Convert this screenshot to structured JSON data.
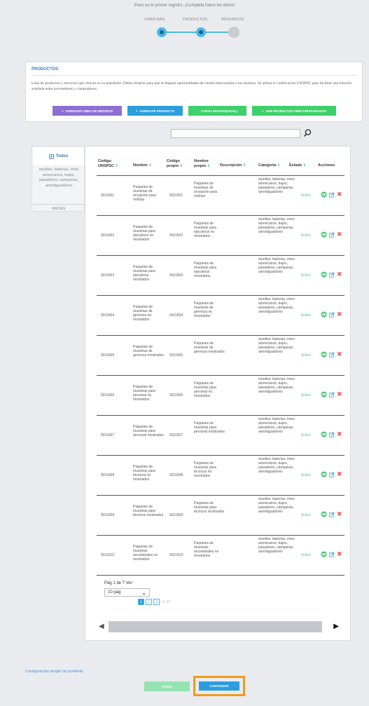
{
  "header": {
    "message": "Paso es tu primer registro. ¡Completa todos los datos!"
  },
  "steps": [
    {
      "label": "LÍNEA NAG."
    },
    {
      "label": "PRODUCTOS"
    },
    {
      "label": "REFERIDOS"
    }
  ],
  "products": {
    "title": "PRODUCTOS",
    "description": "Lista de productos y servicios que ofreces en su portafolio. Debes listarlos para que te lleguen oportunidades de ventas relacionadas a los mismos. Se utiliza la codificación UNSPSC para facilitar una relación acertada entre proveedores y compradores.",
    "buttons": {
      "add_line": "AGREGAR LÍNEA DE NEGOCIO",
      "add_product": "AGREGAR PRODUCTO",
      "bulk_load": "CARGA MASIVA(EXCEL)",
      "view_preconfigured": "VER PRODUCTOS PRECONFIGURADOS"
    }
  },
  "search": {
    "placeholder": ""
  },
  "sidebar": {
    "tab_all": "Todos",
    "category": "muelles, baterías, rines americanos, bujes, pasadores, campanas, amortiguadores",
    "networks": "REDES"
  },
  "table": {
    "headers": {
      "unspsc": "Código UNSPSC",
      "name": "Nombre",
      "own_code": "Código propio",
      "own_name": "Nombre propio",
      "description": "Descripción",
      "category": "Categoría",
      "state": "Estado",
      "actions": "Acciones"
    },
    "rows": [
      {
        "code": "5011501",
        "name": "Paquetes de muestras de recepción para orishas",
        "own_code": "5011501",
        "own_name": "Paquetes de muestras de recepción para orishas",
        "category": "muelles, baterías, rines americanos, bujes, pasadores, campanas, amortiguadores",
        "state": "Activo"
      },
      {
        "code": "5011502",
        "name": "Paquetes de muestras para ejecutivos no mostrados",
        "own_code": "5011502",
        "own_name": "Paquetes de muestras para ejecutivos no mostrados",
        "category": "muelles, baterías, rines americanos, bujes, pasadores, campanas, amortiguadores",
        "state": "Activo"
      },
      {
        "code": "5011503",
        "name": "Paquetes de muestras para ejecutivos mostrados",
        "own_code": "5011503",
        "own_name": "Paquetes de muestras para ejecutivos mostrados",
        "category": "muelles, baterías, rines americanos, bujes, pasadores, campanas, amortiguadores",
        "state": "Activo"
      },
      {
        "code": "5011504",
        "name": "Paquetes de muestras de gerencia no mostrados",
        "own_code": "5011504",
        "own_name": "Paquetes de muestras de gerencia no mostrados",
        "category": "muelles, baterías, rines americanos, bujes, pasadores, campanas, amortiguadores",
        "state": "Activo"
      },
      {
        "code": "5011505",
        "name": "Paquetes de muestras de gerencia mostrados",
        "own_code": "5011505",
        "own_name": "Paquetes de muestras de gerencia mostrados",
        "category": "muelles, baterías, rines americanos, bujes, pasadores, campanas, amortiguadores",
        "state": "Activo"
      },
      {
        "code": "5011506",
        "name": "Paquetes de muestras para personal no mostrados",
        "own_code": "5011506",
        "own_name": "Paquetes de muestras para personal no mostrados",
        "category": "muelles, baterías, rines americanos, bujes, pasadores, campanas, amortiguadores",
        "state": "Activo"
      },
      {
        "code": "5011507",
        "name": "Paquetes de muestras para personal mostrados",
        "own_code": "5011507",
        "own_name": "Paquetes de muestras para personal mostrados",
        "category": "muelles, baterías, rines americanos, bujes, pasadores, campanas, amortiguadores",
        "state": "Activo"
      },
      {
        "code": "5011508",
        "name": "Paquetes de muestras para técnicos no mostrados",
        "own_code": "5011508",
        "own_name": "Paquetes de muestras para técnicos no mostrados",
        "category": "muelles, baterías, rines americanos, bujes, pasadores, campanas, amortiguadores",
        "state": "Activo"
      },
      {
        "code": "5011509",
        "name": "Paquetes de muestras para técnicos mostrados",
        "own_code": "5011509",
        "own_name": "Paquetes de muestras para técnicos mostrados",
        "category": "muelles, baterías, rines americanos, bujes, pasadores, campanas, amortiguadores",
        "state": "Activo"
      },
      {
        "code": "5011510",
        "name": "Paquetes de muestras secretariales no mostrados",
        "own_code": "5011510",
        "own_name": "Paquetes de muestras secretariales no mostrados",
        "category": "muelles, baterías, rines americanos, bujes, pasadores, campanas, amortiguadores",
        "state": "Activo"
      }
    ]
  },
  "pagination": {
    "text": "Pág 1 de 7 Ver:",
    "per_page": "10 pág",
    "pages": [
      "1",
      "2",
      "3"
    ],
    "nav": "> >>"
  },
  "footer": {
    "config_link": "Configuración simple de portafolio",
    "back": "ATRÁS",
    "continue": "CONTINUAR"
  },
  "colors": {
    "accent": "#2c9edd",
    "purple": "#8d6fd4",
    "green": "#3ed06a",
    "highlight": "#f39a1c",
    "delete": "#e0302a"
  }
}
